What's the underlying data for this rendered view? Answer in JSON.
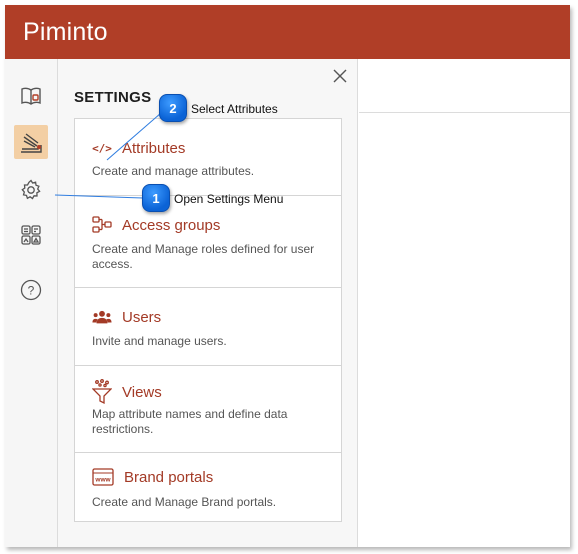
{
  "app": {
    "title": "Piminto"
  },
  "rail": {
    "items": [
      {
        "icon": "catalog-book-icon",
        "active": false
      },
      {
        "icon": "data-import-icon",
        "active": true
      },
      {
        "icon": "settings-gear-icon",
        "active": false
      },
      {
        "icon": "dashboard-widgets-icon",
        "active": false
      },
      {
        "icon": "help-icon",
        "active": false
      }
    ],
    "help_glyph": "?"
  },
  "settings": {
    "title": "SETTINGS",
    "close_glyph": "✕",
    "items": [
      {
        "label": "Attributes",
        "description": "Create and manage attributes.",
        "icon": "code-tag-icon",
        "glyph": "</>"
      },
      {
        "label": "Access groups",
        "description": "Create and Manage roles defined for user access.",
        "icon": "access-groups-icon"
      },
      {
        "label": "Users",
        "description": "Invite and manage users.",
        "icon": "users-icon"
      },
      {
        "label": "Views",
        "description": "Map attribute names and define data restrictions.",
        "icon": "funnel-filter-icon"
      },
      {
        "label": "Brand portals",
        "description": "Create and Manage Brand portals.",
        "icon": "web-portal-icon",
        "glyph": "www"
      }
    ]
  },
  "callouts": [
    {
      "number": "1",
      "text": "Open Settings Menu"
    },
    {
      "number": "2",
      "text": "Select Attributes"
    }
  ],
  "colors": {
    "brand": "#b03e27",
    "accent_text": "#a33a26",
    "active_rail": "#f3cfa4",
    "callout_blue": "#0b63d6"
  }
}
